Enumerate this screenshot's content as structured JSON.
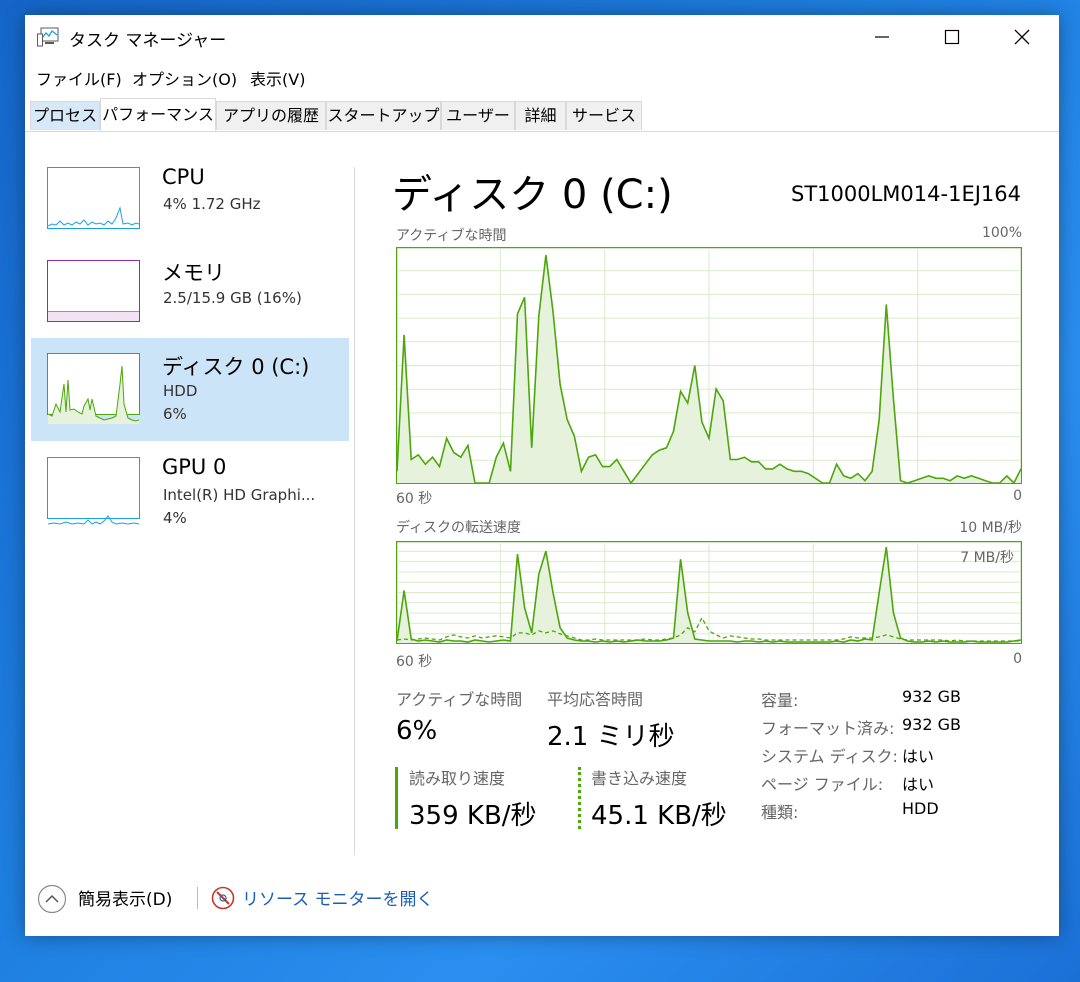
{
  "window": {
    "title": "タスク マネージャー"
  },
  "menu": [
    "ファイル(F)",
    "オプション(O)",
    "表示(V)"
  ],
  "tabs": [
    "プロセス",
    "パフォーマンス",
    "アプリの履歴",
    "スタートアップ",
    "ユーザー",
    "詳細",
    "サービス"
  ],
  "active_tab": "パフォーマンス",
  "sidebar": {
    "items": [
      {
        "title": "CPU",
        "line1": "4%  1.72 GHz",
        "line2": "",
        "color": "#1ba1e2"
      },
      {
        "title": "メモリ",
        "line1": "2.5/15.9 GB (16%)",
        "line2": "",
        "color": "#9b27af"
      },
      {
        "title": "ディスク 0 (C:)",
        "line1": "HDD",
        "line2": "6%",
        "color": "#4da60c"
      },
      {
        "title": "GPU 0",
        "line1": "Intel(R) HD Graphi...",
        "line2": "4%",
        "color": "#1ba1e2"
      }
    ],
    "selected": "ディスク 0 (C:)"
  },
  "main": {
    "title": "ディスク 0 (C:)",
    "model": "ST1000LM014-1EJ164",
    "chart1": {
      "label": "アクティブな時間",
      "max_label": "100%",
      "x_left": "60 秒",
      "x_right": "0"
    },
    "chart2": {
      "label": "ディスクの転送速度",
      "max_label": "10 MB/秒",
      "inner_label": "7 MB/秒",
      "x_left": "60 秒",
      "x_right": "0"
    }
  },
  "stats": {
    "active_time_label": "アクティブな時間",
    "active_time_value": "6%",
    "response_label": "平均応答時間",
    "response_value": "2.1 ミリ秒",
    "read_label": "読み取り速度",
    "read_value": "359 KB/秒",
    "write_label": "書き込み速度",
    "write_value": "45.1 KB/秒"
  },
  "properties": [
    {
      "label": "容量:",
      "value": "932 GB"
    },
    {
      "label": "フォーマット済み:",
      "value": "932 GB"
    },
    {
      "label": "システム ディスク:",
      "value": "はい"
    },
    {
      "label": "ページ ファイル:",
      "value": "はい"
    },
    {
      "label": "種類:",
      "value": "HDD"
    }
  ],
  "footer": {
    "fewer_details": "簡易表示(D)",
    "resource_monitor": "リソース モニターを開く"
  },
  "colors": {
    "disk_green": "#4da60c",
    "disk_fill": "#e6f2dc",
    "grid": "#d9ecc9",
    "accent_blue": "#1ba1e2",
    "memory_purple": "#9b27af",
    "selected_bg": "#cce4f7"
  },
  "chart_data": [
    {
      "type": "area",
      "title": "アクティブな時間",
      "ylim": [
        0,
        100
      ],
      "x_label_left": "60 秒",
      "x_label_right": "0",
      "series": [
        {
          "values": [
            5,
            63,
            10,
            12,
            8,
            11,
            7,
            19,
            13,
            11,
            16,
            0,
            0,
            0,
            11,
            17,
            5,
            72,
            79,
            15,
            71,
            97,
            73,
            42,
            27,
            20,
            5,
            11,
            12,
            7,
            7,
            10,
            5,
            0,
            4,
            8,
            12,
            14,
            15,
            22,
            39,
            34,
            50,
            26,
            19,
            40,
            35,
            10,
            10,
            11,
            9,
            9,
            6,
            6,
            8,
            6,
            5,
            5,
            4,
            2,
            0,
            0,
            8,
            3,
            2,
            4,
            1,
            5,
            27,
            76,
            36,
            1,
            0,
            1,
            2,
            3,
            2,
            2,
            1,
            3,
            2,
            3,
            2,
            1,
            0,
            0,
            3,
            0,
            6
          ]
        }
      ]
    },
    {
      "type": "line",
      "title": "ディスクの転送速度",
      "ylim": [
        0,
        10
      ],
      "y_marker": "7 MB/秒",
      "x_label_left": "60 秒",
      "x_label_right": "0",
      "series": [
        {
          "name": "読み取り速度",
          "values": [
            0.2,
            5.2,
            0.4,
            0.2,
            0.3,
            0.2,
            0.1,
            0.3,
            0.2,
            0.2,
            0.1,
            0.3,
            0.2,
            0.1,
            0.2,
            0.3,
            0.2,
            8.8,
            3.5,
            1.0,
            6.8,
            9.1,
            5.0,
            1.5,
            0.5,
            0.3,
            0.2,
            0.2,
            0.1,
            0.2,
            0.1,
            0.2,
            0.1,
            0.2,
            0.3,
            0.2,
            0.2,
            0.2,
            0.3,
            0.5,
            8.3,
            3.0,
            0.4,
            0.3,
            0.2,
            0.2,
            0.2,
            0.2,
            0.1,
            0.2,
            0.2,
            0.1,
            0.2,
            0.1,
            0.2,
            0.1,
            0.1,
            0.1,
            0.1,
            0.1,
            0.1,
            0.1,
            0.2,
            0.1,
            0.3,
            0.2,
            0.4,
            0.3,
            5.0,
            9.5,
            3.0,
            0.5,
            0.2,
            0.1,
            0.1,
            0.2,
            0.1,
            0.2,
            0.1,
            0.1,
            0.1,
            0.2,
            0.1,
            0.1,
            0.1,
            0.1,
            0.1,
            0.2,
            0.3
          ]
        },
        {
          "name": "書き込み速度",
          "values": [
            0.3,
            0.4,
            0.3,
            0.4,
            0.5,
            0.4,
            0.3,
            0.6,
            0.8,
            0.6,
            0.5,
            0.7,
            0.5,
            0.6,
            0.7,
            0.6,
            0.5,
            1.0,
            1.0,
            0.8,
            1.2,
            1.0,
            1.2,
            0.9,
            0.7,
            0.5,
            0.3,
            0.3,
            0.4,
            0.3,
            0.3,
            0.3,
            0.3,
            0.3,
            0.3,
            0.4,
            0.3,
            0.3,
            0.4,
            0.5,
            0.8,
            1.5,
            1.1,
            2.5,
            1.2,
            0.8,
            0.5,
            0.7,
            0.6,
            0.5,
            0.4,
            0.4,
            0.3,
            0.3,
            0.3,
            0.3,
            0.3,
            0.3,
            0.3,
            0.3,
            0.3,
            0.3,
            0.3,
            0.4,
            0.6,
            0.5,
            0.5,
            0.5,
            0.6,
            0.8,
            0.6,
            0.4,
            0.3,
            0.3,
            0.3,
            0.3,
            0.3,
            0.3,
            0.2,
            0.3,
            0.2,
            0.2,
            0.2,
            0.2,
            0.2,
            0.2,
            0.2,
            0.2,
            0.2
          ]
        }
      ]
    }
  ]
}
